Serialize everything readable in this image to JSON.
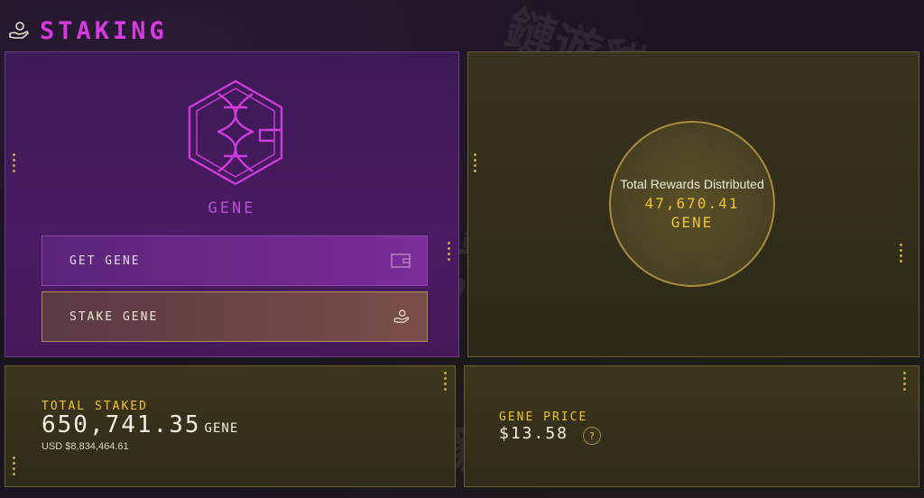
{
  "header": {
    "title": "STAKING",
    "icon": "hand-coin-icon"
  },
  "gene_panel": {
    "token_name": "GENE",
    "logo": "gene-logo-icon",
    "buttons": [
      {
        "label": "GET GENE",
        "icon": "wallet-icon"
      },
      {
        "label": "STAKE GENE",
        "icon": "hand-coin-icon"
      }
    ]
  },
  "rewards": {
    "label": "Total Rewards Distributed",
    "value": "47,670.41",
    "unit": "GENE"
  },
  "total_staked": {
    "label": "TOTAL STAKED",
    "value": "650,741.35",
    "unit": "GENE",
    "usd": "USD $8,834,464.61"
  },
  "gene_price": {
    "label": "GENE PRICE",
    "value": "$13.58",
    "help": "?"
  },
  "watermark": {
    "cjk": "鏈遊貓",
    "url": "catcat.pro"
  },
  "colors": {
    "accent_purple": "#d53ae0",
    "accent_gold": "#f0c232"
  }
}
